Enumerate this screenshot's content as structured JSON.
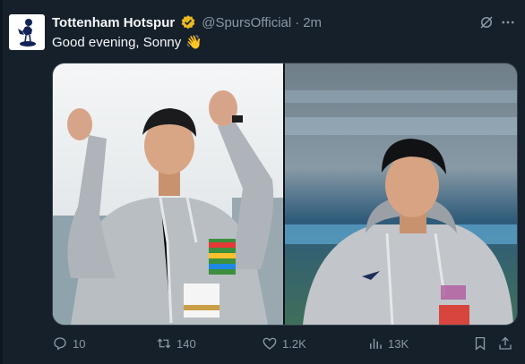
{
  "tweet": {
    "display_name": "Tottenham Hotspur",
    "handle": "@SpursOfficial",
    "separator": "·",
    "time": "2m",
    "text": "Good evening, Sonny",
    "emoji": "👋",
    "avatar_icon": "spurs-cockerel-logo",
    "verified_color": "#e8b923"
  },
  "actions": {
    "replies": "10",
    "retweets": "140",
    "likes": "1.2K",
    "views": "13K"
  },
  "colors": {
    "background": "#15202b",
    "text": "#f7f9f9",
    "muted": "#8b98a5"
  }
}
